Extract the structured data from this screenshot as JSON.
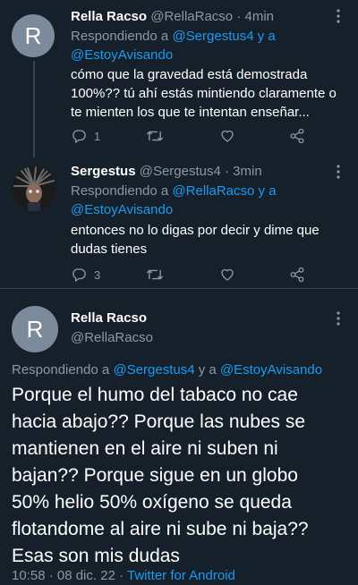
{
  "tweets": [
    {
      "display_name": "Rella Racso",
      "handle": "@RellaRacso",
      "time": "· 4min",
      "reply_prefix": "Respondiendo a",
      "reply_to_1": "@Sergestus4",
      "reply_and": "y a",
      "reply_to_2": "@EstoyAvisando",
      "lines": [
        "cómo que la gravedad está demostrada",
        "100%?? tú ahí estás mintiendo claramente o",
        "te mienten los que te intentan enseñar..."
      ],
      "reply_count": "1",
      "avatar_letter": "R"
    },
    {
      "display_name": "Sergestus",
      "handle": "@Sergestus4",
      "time": "· 3min",
      "reply_prefix": "Respondiendo a",
      "reply_to_1": "@RellaRacso",
      "reply_and": "y a",
      "reply_to_2": "@EstoyAvisando",
      "lines": [
        "entonces no lo digas por decir y dime que",
        "dudas tienes"
      ],
      "reply_count": "3"
    }
  ],
  "main_tweet": {
    "display_name": "Rella Racso",
    "handle": "@RellaRacso",
    "avatar_letter": "R",
    "reply_prefix": "Respondiendo a",
    "reply_to_1": "@Sergestus4",
    "reply_and": "y a",
    "reply_to_2": "@EstoyAvisando",
    "lines": [
      "Porque el humo del tabaco no cae",
      "hacia abajo?? Porque las nubes se",
      "mantienen en el aire ni suben ni",
      "bajan?? Porque sigue en un globo",
      "50% helio 50% oxígeno se queda",
      "flotandome al aire ni sube ni baja??",
      "Esas son mis dudas"
    ],
    "meta_time": "10:58 · 08 dic. 22 ·",
    "meta_source": "Twitter for Android"
  },
  "icons": {
    "more": "more-icon",
    "reply": "reply-icon",
    "retweet": "retweet-icon",
    "like": "like-icon",
    "share": "share-icon"
  }
}
